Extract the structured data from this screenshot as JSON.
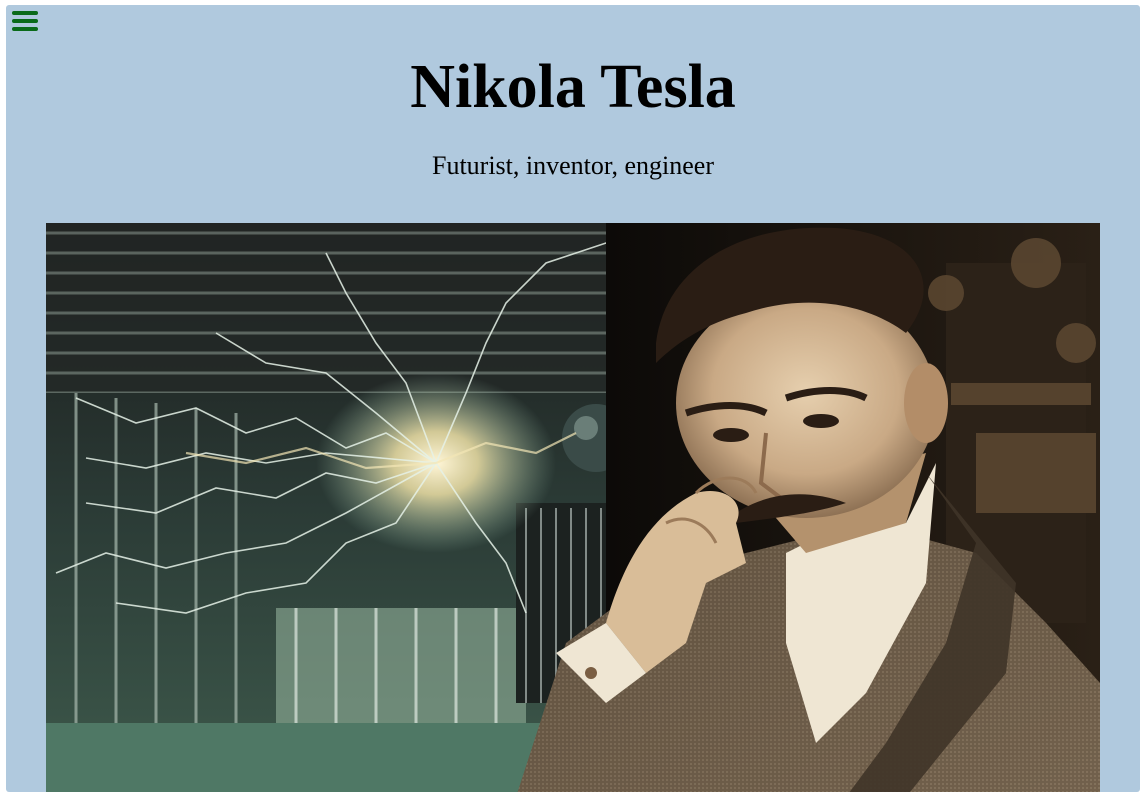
{
  "header": {
    "title": "Nikola Tesla",
    "subtitle": "Futurist, inventor, engineer"
  },
  "menu": {
    "icon": "hamburger-icon",
    "color": "#0a6a1a"
  },
  "hero_image": {
    "alt": "Nikola Tesla"
  },
  "colors": {
    "page_background": "#b0c9de",
    "text": "#000000"
  }
}
